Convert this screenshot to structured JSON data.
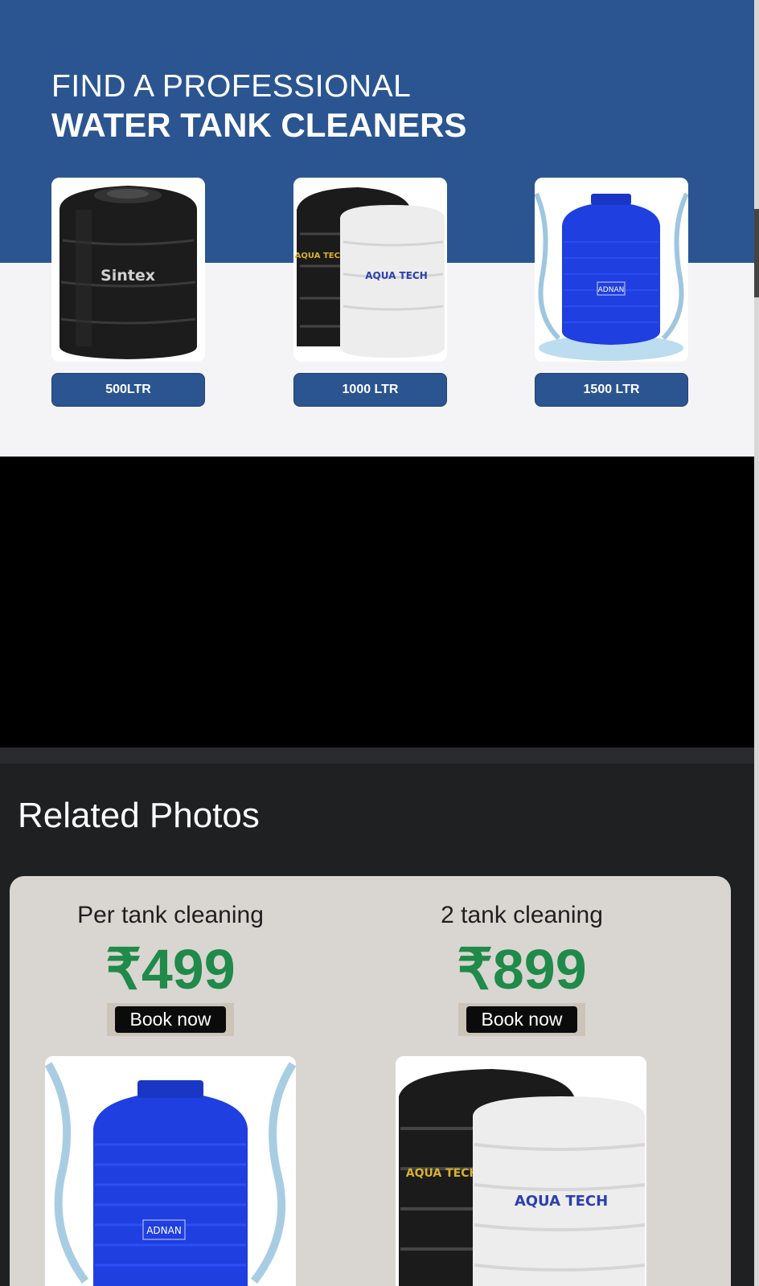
{
  "hero": {
    "title_line1": "FIND A PROFESSIONAL",
    "title_line2": "WATER TANK CLEANERS",
    "colors": {
      "banner_blue": "#2b5591",
      "banner_light": "#f4f4f6"
    },
    "tanks": [
      {
        "brand": "Sintex",
        "capacity": "500LTR"
      },
      {
        "brand_dark": "AQUA TECH",
        "brand": "AQUA TECH",
        "capacity": "1000 LTR"
      },
      {
        "brand": "ADNAN",
        "capacity": "1500 LTR"
      }
    ]
  },
  "related": {
    "title": "Related Photos",
    "plans": [
      {
        "name": "Per tank cleaning",
        "price": "₹499",
        "button": "Book now",
        "brand": "ADNAN"
      },
      {
        "name": "2 tank cleaning",
        "price": "₹899",
        "button": "Book now",
        "brand_dark": "AQUA TECH",
        "brand": "AQUA TECH"
      }
    ],
    "colors": {
      "price_green": "#1f8a49",
      "card_bg": "#d9d6d1"
    }
  }
}
